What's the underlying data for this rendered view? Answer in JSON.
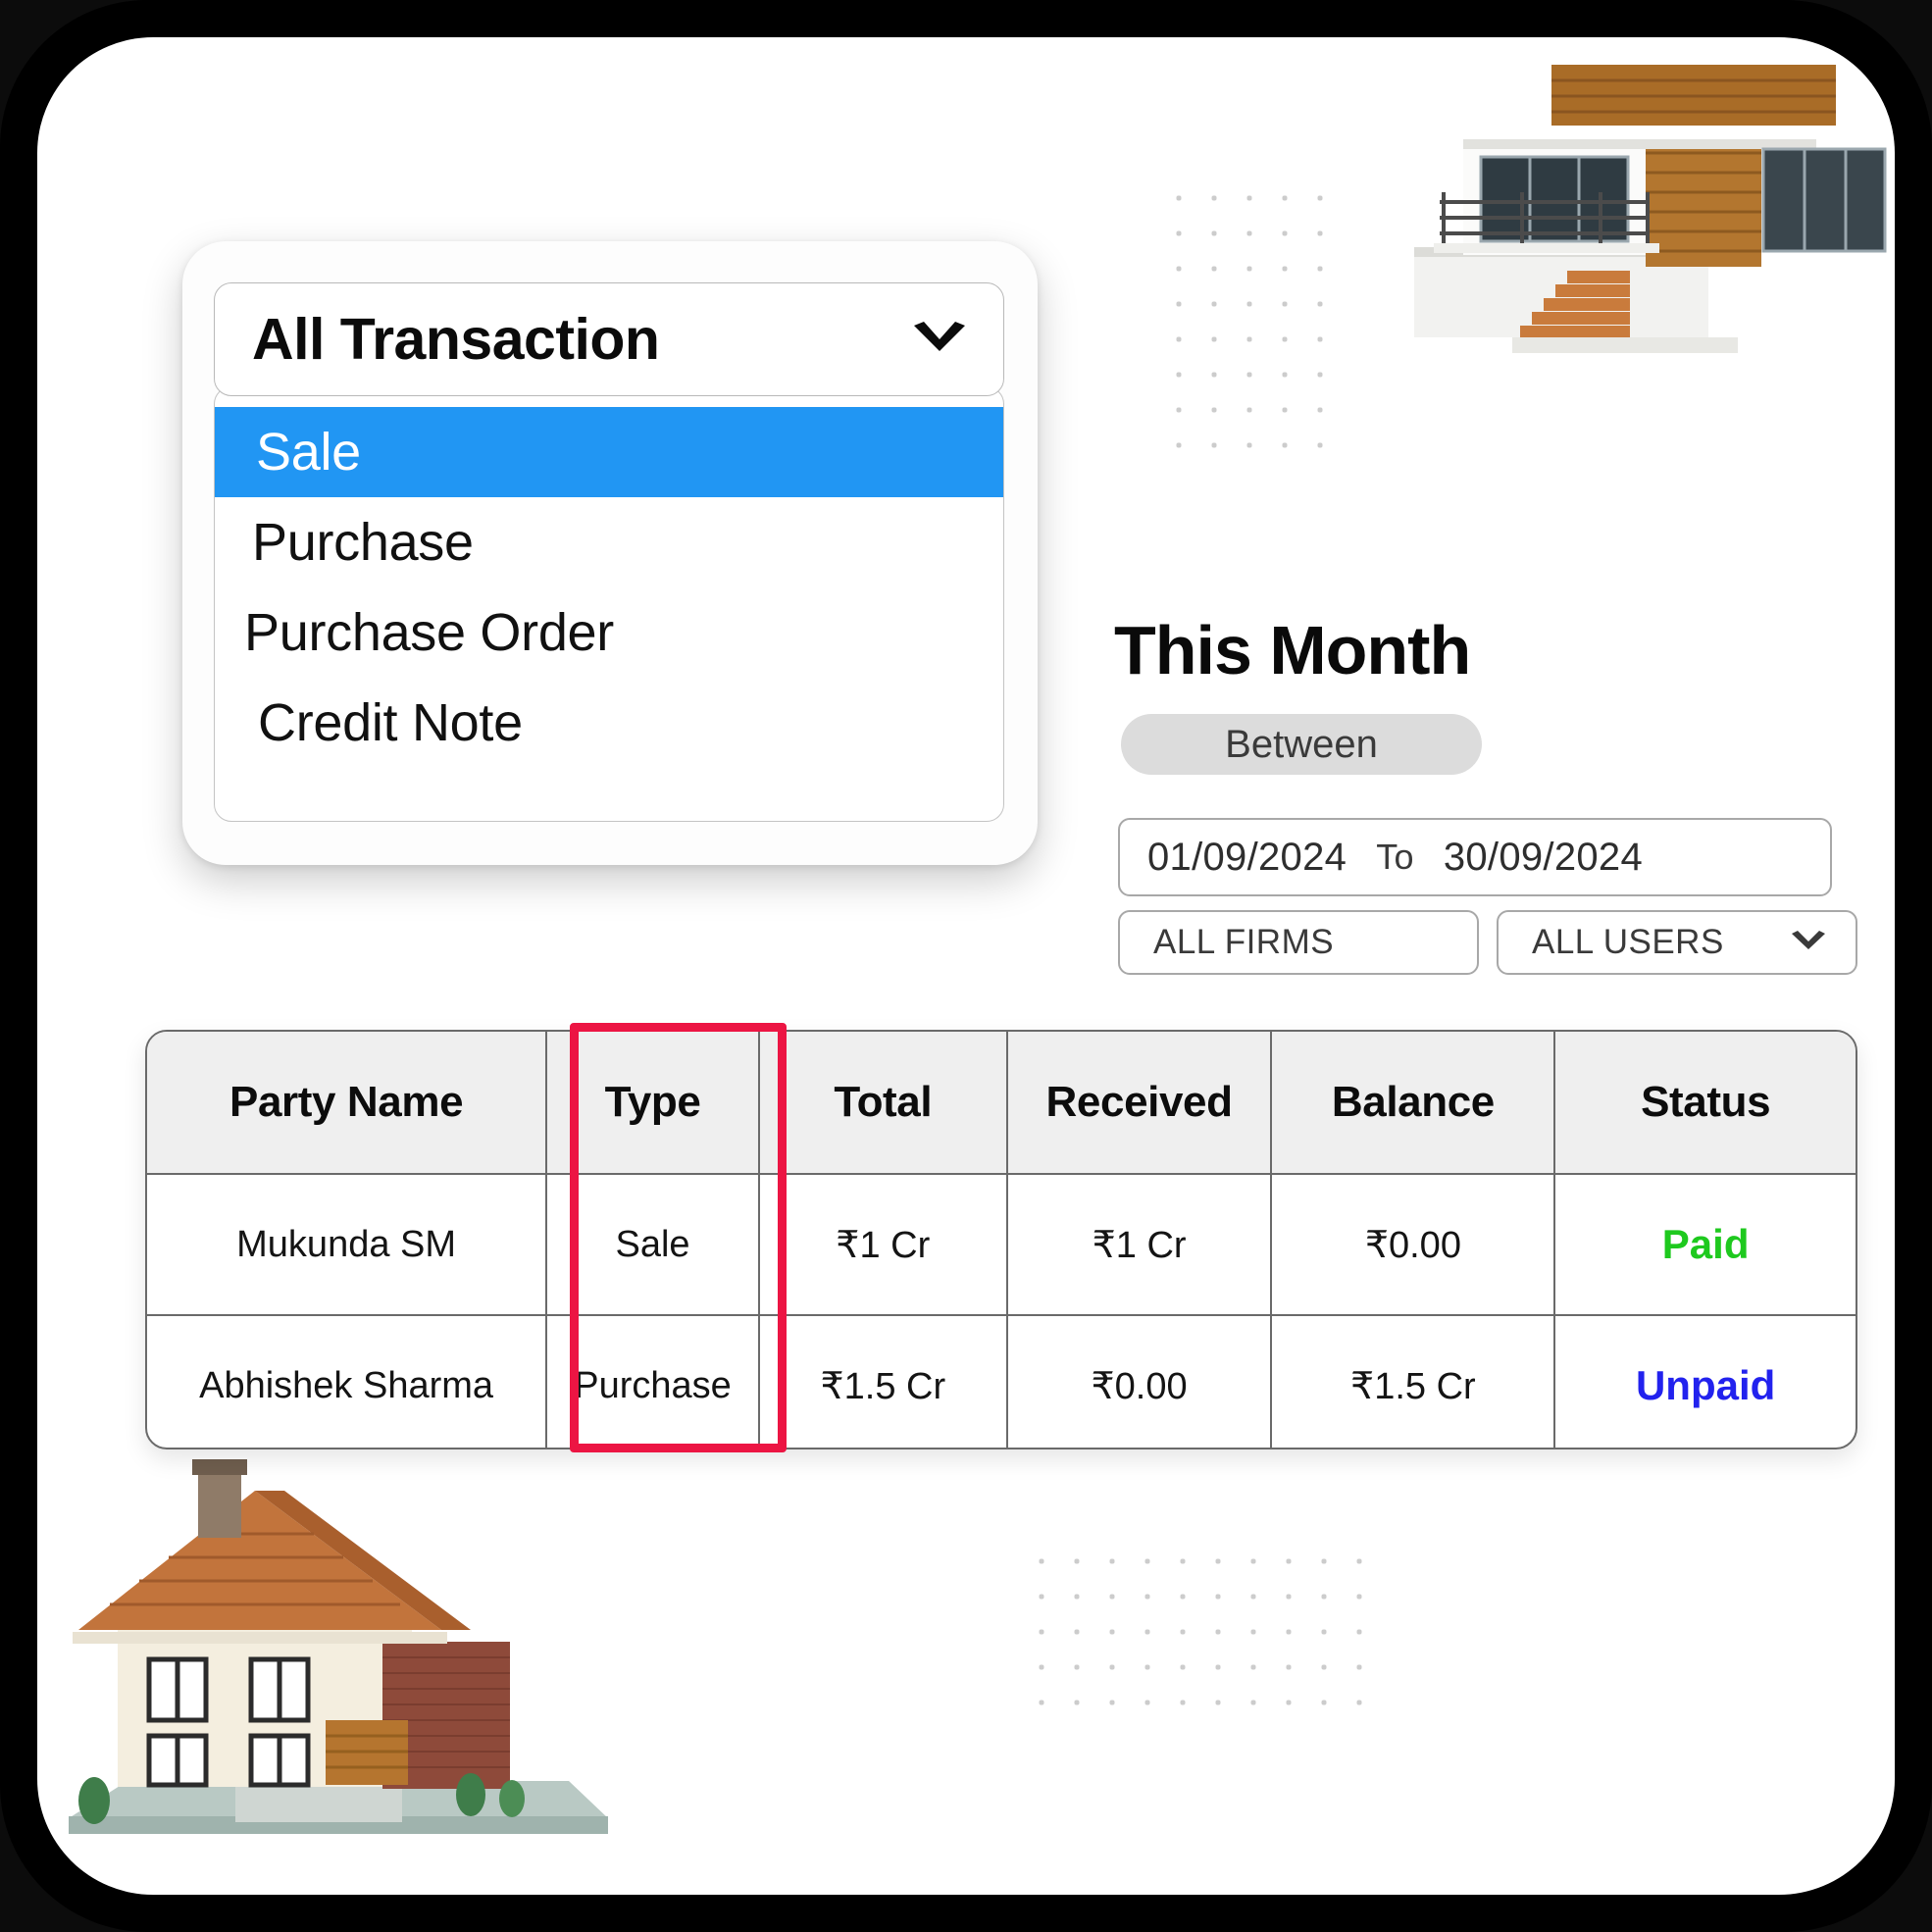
{
  "transaction_filter": {
    "selected_value": "All Transaction",
    "chevron_icon": "chevron-down-icon",
    "options": [
      {
        "label": "Sale",
        "selected": true
      },
      {
        "label": "Purchase",
        "selected": false
      },
      {
        "label": "Purchase Order",
        "selected": false
      },
      {
        "label": "Credit Note",
        "selected": false
      }
    ]
  },
  "period": {
    "title": "This Month",
    "mode_pill": "Between",
    "date_from": "01/09/2024",
    "date_separator": "To",
    "date_to": "30/09/2024",
    "firm_filter": "ALL FIRMS",
    "user_filter": "ALL USERS",
    "user_filter_icon": "chevron-down-icon"
  },
  "table": {
    "columns": [
      "Party Name",
      "Type",
      "Total",
      "Received",
      "Balance",
      "Status"
    ],
    "rows": [
      {
        "party_name": "Mukunda SM",
        "type": "Sale",
        "total": "₹1 Cr",
        "received": "₹1 Cr",
        "balance": "₹0.00",
        "status": "Paid",
        "status_color": "#1ec91e"
      },
      {
        "party_name": "Abhishek Sharma",
        "type": "Purchase",
        "total": "₹1.5 Cr",
        "received": "₹0.00",
        "balance": "₹1.5 Cr",
        "status": "Unpaid",
        "status_color": "#2222ee"
      }
    ],
    "highlight": {
      "column": "Type",
      "color": "#ec1543"
    }
  },
  "decor": {
    "modern_house_image": "modern-house-illustration",
    "cottage_house_image": "cottage-house-illustration",
    "dot_grid_top": "dot-grid-pattern",
    "dot_grid_bottom": "dot-grid-pattern"
  },
  "colors": {
    "accent_blue": "#2196f3",
    "highlight_red": "#ec1543",
    "paid_green": "#1ec91e",
    "unpaid_blue": "#2222ee",
    "pill_gray": "#dcdcdc"
  }
}
